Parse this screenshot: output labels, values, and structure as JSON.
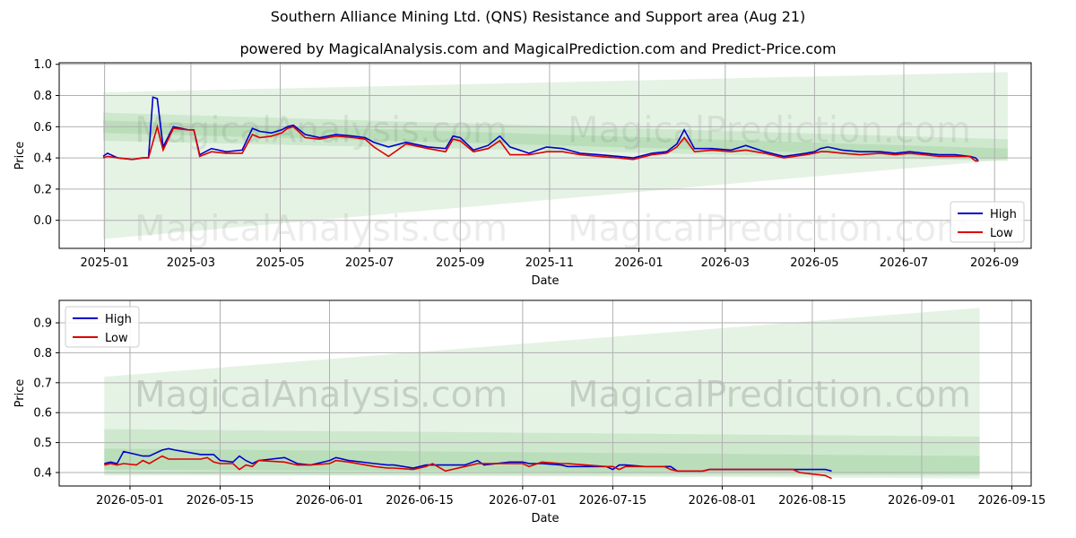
{
  "header": {
    "title": "Southern Alliance Mining Ltd. (QNS) Resistance and Support area (Aug 21)",
    "subtitle": "powered by MagicalAnalysis.com and MagicalPrediction.com and Predict-Price.com"
  },
  "watermarks": [
    "MagicalAnalysis.com",
    "MagicalPrediction.com"
  ],
  "colors": {
    "high": "#0000cc",
    "low": "#dd0000",
    "band": "#2ca02c",
    "grid": "#b0b0b0"
  },
  "chart_data": [
    {
      "type": "line",
      "xlabel": "Date",
      "ylabel": "Price",
      "ylim": [
        -0.18,
        1.01
      ],
      "xlim": [
        "2024-12-01",
        "2026-09-26"
      ],
      "x_ticks": [
        "2025-01",
        "2025-03",
        "2025-05",
        "2025-07",
        "2025-09",
        "2025-11",
        "2026-01",
        "2026-03",
        "2026-05",
        "2026-07",
        "2026-09"
      ],
      "y_ticks": [
        "0.0",
        "0.2",
        "0.4",
        "0.6",
        "0.8",
        "1.0"
      ],
      "legend": "bottom-right",
      "grid": true,
      "bands": [
        {
          "x": [
            "2024-12-31",
            "2026-09-10"
          ],
          "upper": [
            0.82,
            0.95
          ],
          "lower": [
            -0.12,
            0.39
          ]
        },
        {
          "x": [
            "2024-12-31",
            "2026-09-10"
          ],
          "upper": [
            0.69,
            0.52
          ],
          "lower": [
            0.51,
            0.38
          ]
        },
        {
          "x": [
            "2024-12-31",
            "2026-09-10"
          ],
          "upper": [
            0.64,
            0.46
          ],
          "lower": [
            0.56,
            0.4
          ]
        }
      ],
      "series": [
        {
          "name": "High",
          "x": [
            "2024-12-31",
            "2025-01-03",
            "2025-01-10",
            "2025-01-20",
            "2025-01-27",
            "2025-01-31",
            "2025-02-03",
            "2025-02-06",
            "2025-02-10",
            "2025-02-17",
            "2025-02-27",
            "2025-03-03",
            "2025-03-07",
            "2025-03-15",
            "2025-03-25",
            "2025-04-05",
            "2025-04-12",
            "2025-04-17",
            "2025-04-25",
            "2025-05-02",
            "2025-05-06",
            "2025-05-10",
            "2025-05-18",
            "2025-05-28",
            "2025-06-08",
            "2025-06-20",
            "2025-06-28",
            "2025-07-04",
            "2025-07-14",
            "2025-07-26",
            "2025-08-10",
            "2025-08-22",
            "2025-08-27",
            "2025-09-01",
            "2025-09-10",
            "2025-09-20",
            "2025-09-28",
            "2025-10-05",
            "2025-10-18",
            "2025-10-30",
            "2025-11-10",
            "2025-11-22",
            "2025-12-05",
            "2025-12-18",
            "2025-12-28",
            "2026-01-10",
            "2026-01-20",
            "2026-01-27",
            "2026-02-01",
            "2026-02-08",
            "2026-02-20",
            "2026-03-05",
            "2026-03-15",
            "2026-03-28",
            "2026-04-10",
            "2026-04-25",
            "2026-05-01",
            "2026-05-05",
            "2026-05-10",
            "2026-05-20",
            "2026-06-01",
            "2026-06-15",
            "2026-06-25",
            "2026-07-05",
            "2026-07-15",
            "2026-07-25",
            "2026-08-05",
            "2026-08-15",
            "2026-08-19",
            "2026-08-21"
          ],
          "values": [
            0.41,
            0.43,
            0.4,
            0.39,
            0.4,
            0.4,
            0.79,
            0.78,
            0.47,
            0.6,
            0.58,
            0.58,
            0.42,
            0.46,
            0.44,
            0.45,
            0.59,
            0.57,
            0.56,
            0.58,
            0.6,
            0.61,
            0.55,
            0.53,
            0.55,
            0.54,
            0.53,
            0.5,
            0.47,
            0.5,
            0.47,
            0.46,
            0.54,
            0.53,
            0.45,
            0.48,
            0.54,
            0.47,
            0.43,
            0.47,
            0.46,
            0.43,
            0.42,
            0.41,
            0.4,
            0.43,
            0.44,
            0.49,
            0.58,
            0.46,
            0.46,
            0.45,
            0.48,
            0.44,
            0.41,
            0.43,
            0.44,
            0.46,
            0.47,
            0.45,
            0.44,
            0.44,
            0.43,
            0.44,
            0.43,
            0.42,
            0.42,
            0.41,
            0.4,
            0.38
          ]
        },
        {
          "name": "Low",
          "x": [
            "2024-12-31",
            "2025-01-03",
            "2025-01-10",
            "2025-01-20",
            "2025-01-27",
            "2025-01-31",
            "2025-02-03",
            "2025-02-06",
            "2025-02-10",
            "2025-02-17",
            "2025-02-27",
            "2025-03-03",
            "2025-03-07",
            "2025-03-15",
            "2025-03-25",
            "2025-04-05",
            "2025-04-12",
            "2025-04-17",
            "2025-04-25",
            "2025-05-02",
            "2025-05-06",
            "2025-05-10",
            "2025-05-18",
            "2025-05-28",
            "2025-06-08",
            "2025-06-20",
            "2025-06-28",
            "2025-07-04",
            "2025-07-14",
            "2025-07-26",
            "2025-08-10",
            "2025-08-22",
            "2025-08-27",
            "2025-09-01",
            "2025-09-10",
            "2025-09-20",
            "2025-09-28",
            "2025-10-05",
            "2025-10-18",
            "2025-10-30",
            "2025-11-10",
            "2025-11-22",
            "2025-12-05",
            "2025-12-18",
            "2025-12-28",
            "2026-01-10",
            "2026-01-20",
            "2026-01-27",
            "2026-02-01",
            "2026-02-08",
            "2026-02-20",
            "2026-03-05",
            "2026-03-15",
            "2026-03-28",
            "2026-04-10",
            "2026-04-25",
            "2026-05-01",
            "2026-05-05",
            "2026-05-10",
            "2026-05-20",
            "2026-06-01",
            "2026-06-15",
            "2026-06-25",
            "2026-07-05",
            "2026-07-15",
            "2026-07-25",
            "2026-08-05",
            "2026-08-15",
            "2026-08-19",
            "2026-08-21"
          ],
          "values": [
            0.4,
            0.41,
            0.4,
            0.39,
            0.4,
            0.4,
            0.5,
            0.6,
            0.45,
            0.59,
            0.58,
            0.58,
            0.41,
            0.44,
            0.43,
            0.43,
            0.55,
            0.53,
            0.54,
            0.56,
            0.59,
            0.6,
            0.53,
            0.52,
            0.54,
            0.53,
            0.52,
            0.47,
            0.41,
            0.49,
            0.46,
            0.44,
            0.52,
            0.51,
            0.44,
            0.46,
            0.51,
            0.42,
            0.42,
            0.44,
            0.44,
            0.42,
            0.41,
            0.4,
            0.39,
            0.42,
            0.43,
            0.47,
            0.53,
            0.44,
            0.45,
            0.44,
            0.45,
            0.43,
            0.4,
            0.42,
            0.43,
            0.44,
            0.44,
            0.43,
            0.42,
            0.43,
            0.42,
            0.43,
            0.42,
            0.41,
            0.41,
            0.41,
            0.38,
            0.38
          ]
        }
      ]
    },
    {
      "type": "line",
      "xlabel": "Date",
      "ylabel": "Price",
      "ylim": [
        0.355,
        0.975
      ],
      "xlim": [
        "2026-04-20",
        "2026-09-18"
      ],
      "x_ticks": [
        "2026-05-01",
        "2026-05-15",
        "2026-06-01",
        "2026-06-15",
        "2026-07-01",
        "2026-07-15",
        "2026-08-01",
        "2026-08-15",
        "2026-09-01",
        "2026-09-15"
      ],
      "y_ticks": [
        "0.4",
        "0.5",
        "0.6",
        "0.7",
        "0.8",
        "0.9"
      ],
      "legend": "top-left",
      "grid": true,
      "bands": [
        {
          "x": [
            "2026-04-27",
            "2026-09-10"
          ],
          "upper": [
            0.72,
            0.95
          ],
          "lower": [
            0.39,
            0.39
          ]
        },
        {
          "x": [
            "2026-04-27",
            "2026-09-10"
          ],
          "upper": [
            0.545,
            0.52
          ],
          "lower": [
            0.395,
            0.38
          ]
        },
        {
          "x": [
            "2026-04-27",
            "2026-09-10"
          ],
          "upper": [
            0.48,
            0.455
          ],
          "lower": [
            0.41,
            0.395
          ]
        }
      ],
      "series": [
        {
          "name": "High",
          "x": [
            "2026-04-27",
            "2026-04-28",
            "2026-04-29",
            "2026-04-30",
            "2026-05-02",
            "2026-05-03",
            "2026-05-04",
            "2026-05-06",
            "2026-05-07",
            "2026-05-08",
            "2026-05-12",
            "2026-05-13",
            "2026-05-14",
            "2026-05-15",
            "2026-05-17",
            "2026-05-18",
            "2026-05-19",
            "2026-05-20",
            "2026-05-21",
            "2026-05-25",
            "2026-05-27",
            "2026-05-29",
            "2026-06-01",
            "2026-06-02",
            "2026-06-04",
            "2026-06-08",
            "2026-06-10",
            "2026-06-11",
            "2026-06-14",
            "2026-06-16",
            "2026-06-17",
            "2026-06-19",
            "2026-06-22",
            "2026-06-24",
            "2026-06-25",
            "2026-06-29",
            "2026-07-01",
            "2026-07-02",
            "2026-07-04",
            "2026-07-07",
            "2026-07-08",
            "2026-07-14",
            "2026-07-15",
            "2026-07-16",
            "2026-07-17",
            "2026-07-20",
            "2026-07-23",
            "2026-07-24",
            "2026-07-25",
            "2026-07-29",
            "2026-07-30",
            "2026-08-01",
            "2026-08-05",
            "2026-08-08",
            "2026-08-12",
            "2026-08-13",
            "2026-08-17",
            "2026-08-18"
          ],
          "values": [
            0.43,
            0.435,
            0.43,
            0.47,
            0.46,
            0.455,
            0.455,
            0.475,
            0.48,
            0.475,
            0.46,
            0.46,
            0.46,
            0.44,
            0.435,
            0.455,
            0.44,
            0.43,
            0.44,
            0.45,
            0.43,
            0.425,
            0.44,
            0.45,
            0.44,
            0.43,
            0.425,
            0.425,
            0.415,
            0.425,
            0.425,
            0.425,
            0.425,
            0.44,
            0.425,
            0.435,
            0.435,
            0.43,
            0.43,
            0.425,
            0.42,
            0.42,
            0.41,
            0.425,
            0.425,
            0.42,
            0.42,
            0.42,
            0.405,
            0.405,
            0.41,
            0.41,
            0.41,
            0.41,
            0.41,
            0.41,
            0.41,
            0.405
          ]
        },
        {
          "name": "Low",
          "x": [
            "2026-04-27",
            "2026-04-28",
            "2026-04-29",
            "2026-04-30",
            "2026-05-02",
            "2026-05-03",
            "2026-05-04",
            "2026-05-06",
            "2026-05-07",
            "2026-05-08",
            "2026-05-12",
            "2026-05-13",
            "2026-05-14",
            "2026-05-15",
            "2026-05-17",
            "2026-05-18",
            "2026-05-19",
            "2026-05-20",
            "2026-05-21",
            "2026-05-25",
            "2026-05-27",
            "2026-05-29",
            "2026-06-01",
            "2026-06-02",
            "2026-06-04",
            "2026-06-08",
            "2026-06-10",
            "2026-06-11",
            "2026-06-14",
            "2026-06-16",
            "2026-06-17",
            "2026-06-19",
            "2026-06-22",
            "2026-06-24",
            "2026-06-25",
            "2026-06-29",
            "2026-07-01",
            "2026-07-02",
            "2026-07-04",
            "2026-07-07",
            "2026-07-08",
            "2026-07-14",
            "2026-07-15",
            "2026-07-16",
            "2026-07-17",
            "2026-07-20",
            "2026-07-23",
            "2026-07-24",
            "2026-07-25",
            "2026-07-29",
            "2026-07-30",
            "2026-08-01",
            "2026-08-05",
            "2026-08-08",
            "2026-08-12",
            "2026-08-13",
            "2026-08-17",
            "2026-08-18"
          ],
          "values": [
            0.425,
            0.43,
            0.425,
            0.43,
            0.425,
            0.44,
            0.43,
            0.455,
            0.445,
            0.445,
            0.445,
            0.45,
            0.435,
            0.43,
            0.43,
            0.41,
            0.425,
            0.42,
            0.44,
            0.435,
            0.425,
            0.425,
            0.43,
            0.44,
            0.435,
            0.42,
            0.415,
            0.415,
            0.41,
            0.42,
            0.43,
            0.405,
            0.42,
            0.43,
            0.43,
            0.43,
            0.43,
            0.42,
            0.435,
            0.43,
            0.43,
            0.42,
            0.42,
            0.41,
            0.42,
            0.42,
            0.42,
            0.41,
            0.405,
            0.405,
            0.41,
            0.41,
            0.41,
            0.41,
            0.41,
            0.4,
            0.39,
            0.38
          ]
        }
      ]
    }
  ]
}
